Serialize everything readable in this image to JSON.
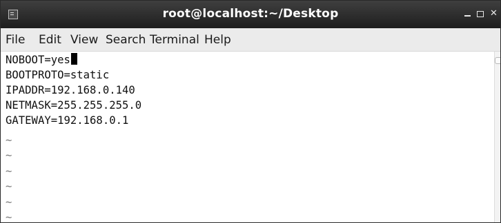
{
  "window": {
    "title": "root@localhost:~/Desktop"
  },
  "menu": {
    "file": "File",
    "edit": "Edit",
    "view": "View",
    "search": "Search",
    "terminal": "Terminal",
    "help": "Help"
  },
  "editor": {
    "lines": [
      "NOBOOT=yes",
      "BOOTPROTO=static",
      "IPADDR=192.168.0.140",
      "NETMASK=255.255.255.0",
      "GATEWAY=192.168.0.1"
    ],
    "empty_marker": "~",
    "empty_line_count": 6
  },
  "colors": {
    "titlebar": "#2b2b2b",
    "menubar": "#ebebeb",
    "text": "#111111",
    "tilde": "#7a7a7a"
  }
}
